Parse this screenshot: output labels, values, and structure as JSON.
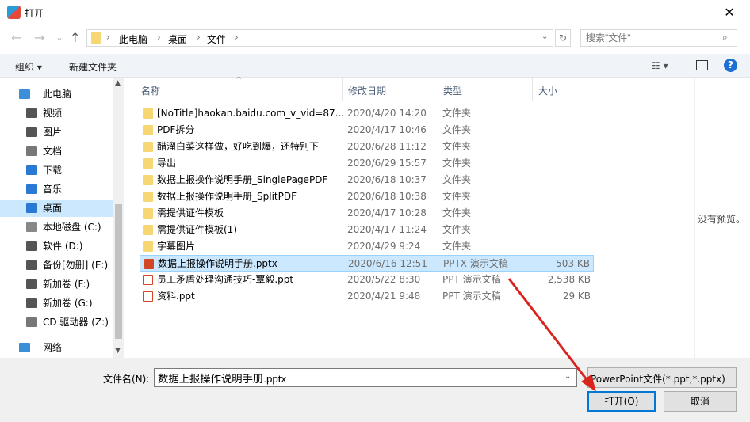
{
  "window": {
    "title": "打开",
    "close": "✕"
  },
  "nav": {
    "back": "←",
    "forward": "→",
    "recent": "⌄",
    "up": "↑",
    "breadcrumb": [
      "此电脑",
      "桌面",
      "文件"
    ],
    "search_placeholder": "搜索\"文件\""
  },
  "toolbar": {
    "organize": "组织 ▾",
    "new_folder": "新建文件夹"
  },
  "sidebar": {
    "items": [
      {
        "label": "此电脑",
        "color": "#3a8fd8"
      },
      {
        "label": "视频",
        "color": "#555"
      },
      {
        "label": "图片",
        "color": "#555"
      },
      {
        "label": "文档",
        "color": "#777"
      },
      {
        "label": "下载",
        "color": "#2a7ad5"
      },
      {
        "label": "音乐",
        "color": "#2a7ad5"
      },
      {
        "label": "桌面",
        "color": "#2a7ad5"
      },
      {
        "label": "本地磁盘 (C:)",
        "color": "#888"
      },
      {
        "label": "软件 (D:)",
        "color": "#555"
      },
      {
        "label": "备份[勿删] (E:)",
        "color": "#555"
      },
      {
        "label": "新加卷 (F:)",
        "color": "#555"
      },
      {
        "label": "新加卷 (G:)",
        "color": "#555"
      },
      {
        "label": "CD 驱动器 (Z:)",
        "color": "#777"
      },
      {
        "label": "网络",
        "color": "#3a8fd8"
      }
    ]
  },
  "columns": {
    "name": "名称",
    "date": "修改日期",
    "type": "类型",
    "size": "大小"
  },
  "files": [
    {
      "name": "[NoTitle]haokan.baidu.com_v_vid=87...",
      "date": "2020/4/20 14:20",
      "type": "文件夹",
      "size": "",
      "kind": "folder"
    },
    {
      "name": "PDF拆分",
      "date": "2020/4/17 10:46",
      "type": "文件夹",
      "size": "",
      "kind": "folder"
    },
    {
      "name": "醋溜白菜这样做，好吃到爆，还特别下",
      "date": "2020/6/28 11:12",
      "type": "文件夹",
      "size": "",
      "kind": "folder"
    },
    {
      "name": "导出",
      "date": "2020/6/29 15:57",
      "type": "文件夹",
      "size": "",
      "kind": "folder"
    },
    {
      "name": "数据上报操作说明手册_SinglePagePDF",
      "date": "2020/6/18 10:37",
      "type": "文件夹",
      "size": "",
      "kind": "folder"
    },
    {
      "name": "数据上报操作说明手册_SplitPDF",
      "date": "2020/6/18 10:38",
      "type": "文件夹",
      "size": "",
      "kind": "folder"
    },
    {
      "name": "需提供证件模板",
      "date": "2020/4/17 10:28",
      "type": "文件夹",
      "size": "",
      "kind": "folder"
    },
    {
      "name": "需提供证件模板(1)",
      "date": "2020/4/17 11:24",
      "type": "文件夹",
      "size": "",
      "kind": "folder"
    },
    {
      "name": "字幕图片",
      "date": "2020/4/29 9:24",
      "type": "文件夹",
      "size": "",
      "kind": "folder"
    },
    {
      "name": "数据上报操作说明手册.pptx",
      "date": "2020/6/16 12:51",
      "type": "PPTX 演示文稿",
      "size": "503 KB",
      "kind": "pptx",
      "selected": true
    },
    {
      "name": "员工矛盾处理沟通技巧-覃毅.ppt",
      "date": "2020/5/22 8:30",
      "type": "PPT 演示文稿",
      "size": "2,538 KB",
      "kind": "ppt"
    },
    {
      "name": "资料.ppt",
      "date": "2020/4/21 9:48",
      "type": "PPT 演示文稿",
      "size": "29 KB",
      "kind": "ppt"
    }
  ],
  "preview": {
    "text": "没有预览。"
  },
  "footer": {
    "filename_label": "文件名(N):",
    "filename_value": "数据上报操作说明手册.pptx",
    "filter": "PowerPoint文件(*.ppt,*.pptx)",
    "open": "打开(O)",
    "cancel": "取消"
  }
}
